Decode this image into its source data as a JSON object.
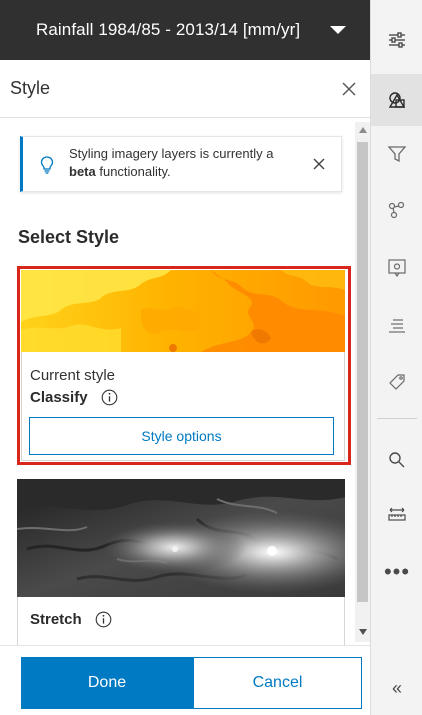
{
  "layer": {
    "title": "Rainfall 1984/85 - 2013/14 [mm/yr]",
    "dropdown_icon": "caret-down-icon"
  },
  "panel": {
    "title": "Style",
    "close_icon": "close-icon"
  },
  "notice": {
    "text_before": "Styling imagery layers is currently a ",
    "text_bold": "beta",
    "text_after": " functionality.",
    "icon": "lightbulb-icon",
    "close_icon": "close-icon"
  },
  "select_style": {
    "title": "Select Style",
    "current": {
      "label": "Current style",
      "name": "Classify",
      "info_icon": "info-icon",
      "options_label": "Style options"
    },
    "stretch": {
      "name": "Stretch",
      "info_icon": "info-icon"
    }
  },
  "footer": {
    "done_label": "Done",
    "cancel_label": "Cancel"
  },
  "toolstrip": {
    "items": [
      "properties-icon",
      "style-icon",
      "filter-icon",
      "effects-icon",
      "configure-popup-icon",
      "fields-icon",
      "labels-icon",
      "search-icon",
      "measure-icon",
      "more-icon",
      "collapse-icon"
    ],
    "more_label": "•••",
    "collapse_label": "«"
  },
  "colors": {
    "accent": "#007ac2",
    "header_bg": "#303030",
    "selected_border": "#d9261c"
  }
}
